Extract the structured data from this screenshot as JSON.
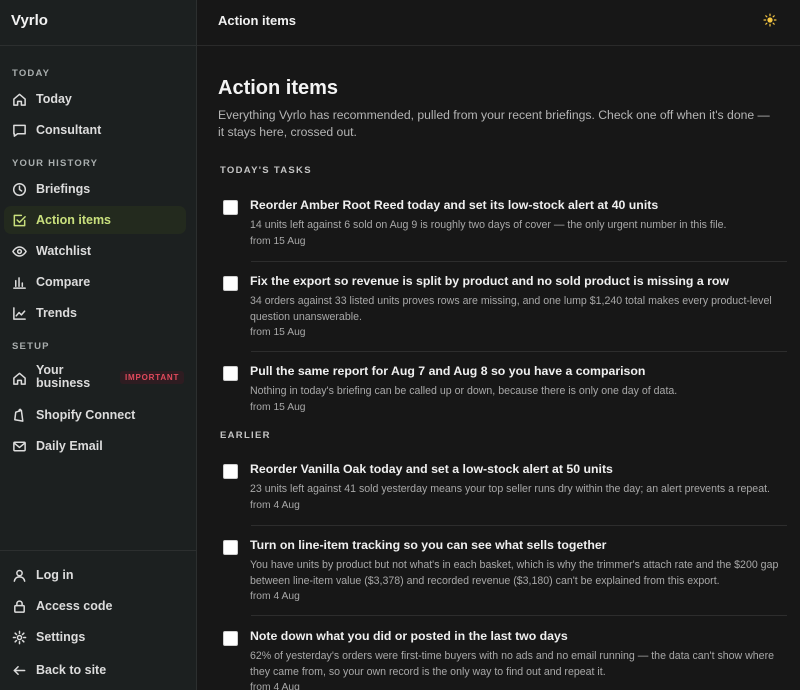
{
  "app": {
    "name": "Vyrlo"
  },
  "sidebar": {
    "sections": {
      "today": "TODAY",
      "history": "YOUR HISTORY",
      "setup": "SETUP"
    },
    "items": [
      {
        "label": "Today",
        "icon": "home-icon"
      },
      {
        "label": "Consultant",
        "icon": "chat-icon"
      },
      {
        "label": "Briefings",
        "icon": "clock-icon"
      },
      {
        "label": "Action items",
        "icon": "checkbox-icon",
        "active": true
      },
      {
        "label": "Watchlist",
        "icon": "eye-icon"
      },
      {
        "label": "Compare",
        "icon": "bar-chart-icon"
      },
      {
        "label": "Trends",
        "icon": "trend-icon"
      },
      {
        "label": "Your business",
        "icon": "store-icon",
        "badge": "IMPORTANT"
      },
      {
        "label": "Shopify Connect",
        "icon": "shopify-icon"
      },
      {
        "label": "Daily Email",
        "icon": "mail-icon"
      }
    ],
    "bottom": [
      {
        "label": "Log in",
        "icon": "user-icon"
      },
      {
        "label": "Access code",
        "icon": "lock-icon"
      },
      {
        "label": "Settings",
        "icon": "gear-icon"
      },
      {
        "label": "Back to site",
        "icon": "arrow-left-icon"
      }
    ]
  },
  "header": {
    "title": "Action items",
    "theme_icon": "sun-icon"
  },
  "colors": {
    "accent": "#c9e07d",
    "badge": "#e24a5c",
    "background": "#171717",
    "sidebar": "#1c2020"
  },
  "main": {
    "title": "Action items",
    "description": "Everything Vyrlo has recommended, pulled from your recent briefings. Check one off when it's done — it stays here, crossed out.",
    "groups": [
      {
        "label": "TODAY'S TASKS",
        "tasks": [
          {
            "title": "Reorder Amber Root Reed today and set its low-stock alert at 40 units",
            "body": "14 units left against 6 sold on Aug 9 is roughly two days of cover — the only urgent number in this file.",
            "from": "from 15 Aug",
            "checked": false
          },
          {
            "title": "Fix the export so revenue is split by product and no sold product is missing a row",
            "body": "34 orders against 33 listed units proves rows are missing, and one lump $1,240 total makes every product-level question unanswerable.",
            "from": "from 15 Aug",
            "checked": false
          },
          {
            "title": "Pull the same report for Aug 7 and Aug 8 so you have a comparison",
            "body": "Nothing in today's briefing can be called up or down, because there is only one day of data.",
            "from": "from 15 Aug",
            "checked": false
          }
        ]
      },
      {
        "label": "EARLIER",
        "tasks": [
          {
            "title": "Reorder Vanilla Oak today and set a low-stock alert at 50 units",
            "body": "23 units left against 41 sold yesterday means your top seller runs dry within the day; an alert prevents a repeat.",
            "from": "from 4 Aug",
            "checked": false
          },
          {
            "title": "Turn on line-item tracking so you can see what sells together",
            "body": "You have units by product but not what's in each basket, which is why the trimmer's attach rate and the $200 gap between line-item value ($3,378) and recorded revenue ($3,180) can't be explained from this export.",
            "from": "from 4 Aug",
            "checked": false
          },
          {
            "title": "Note down what you did or posted in the last two days",
            "body": "62% of yesterday's orders were first-time buyers with no ads and no email running — the data can't show where they came from, so your own record is the only way to find out and repeat it.",
            "from": "from 4 Aug",
            "checked": false
          }
        ]
      }
    ]
  }
}
